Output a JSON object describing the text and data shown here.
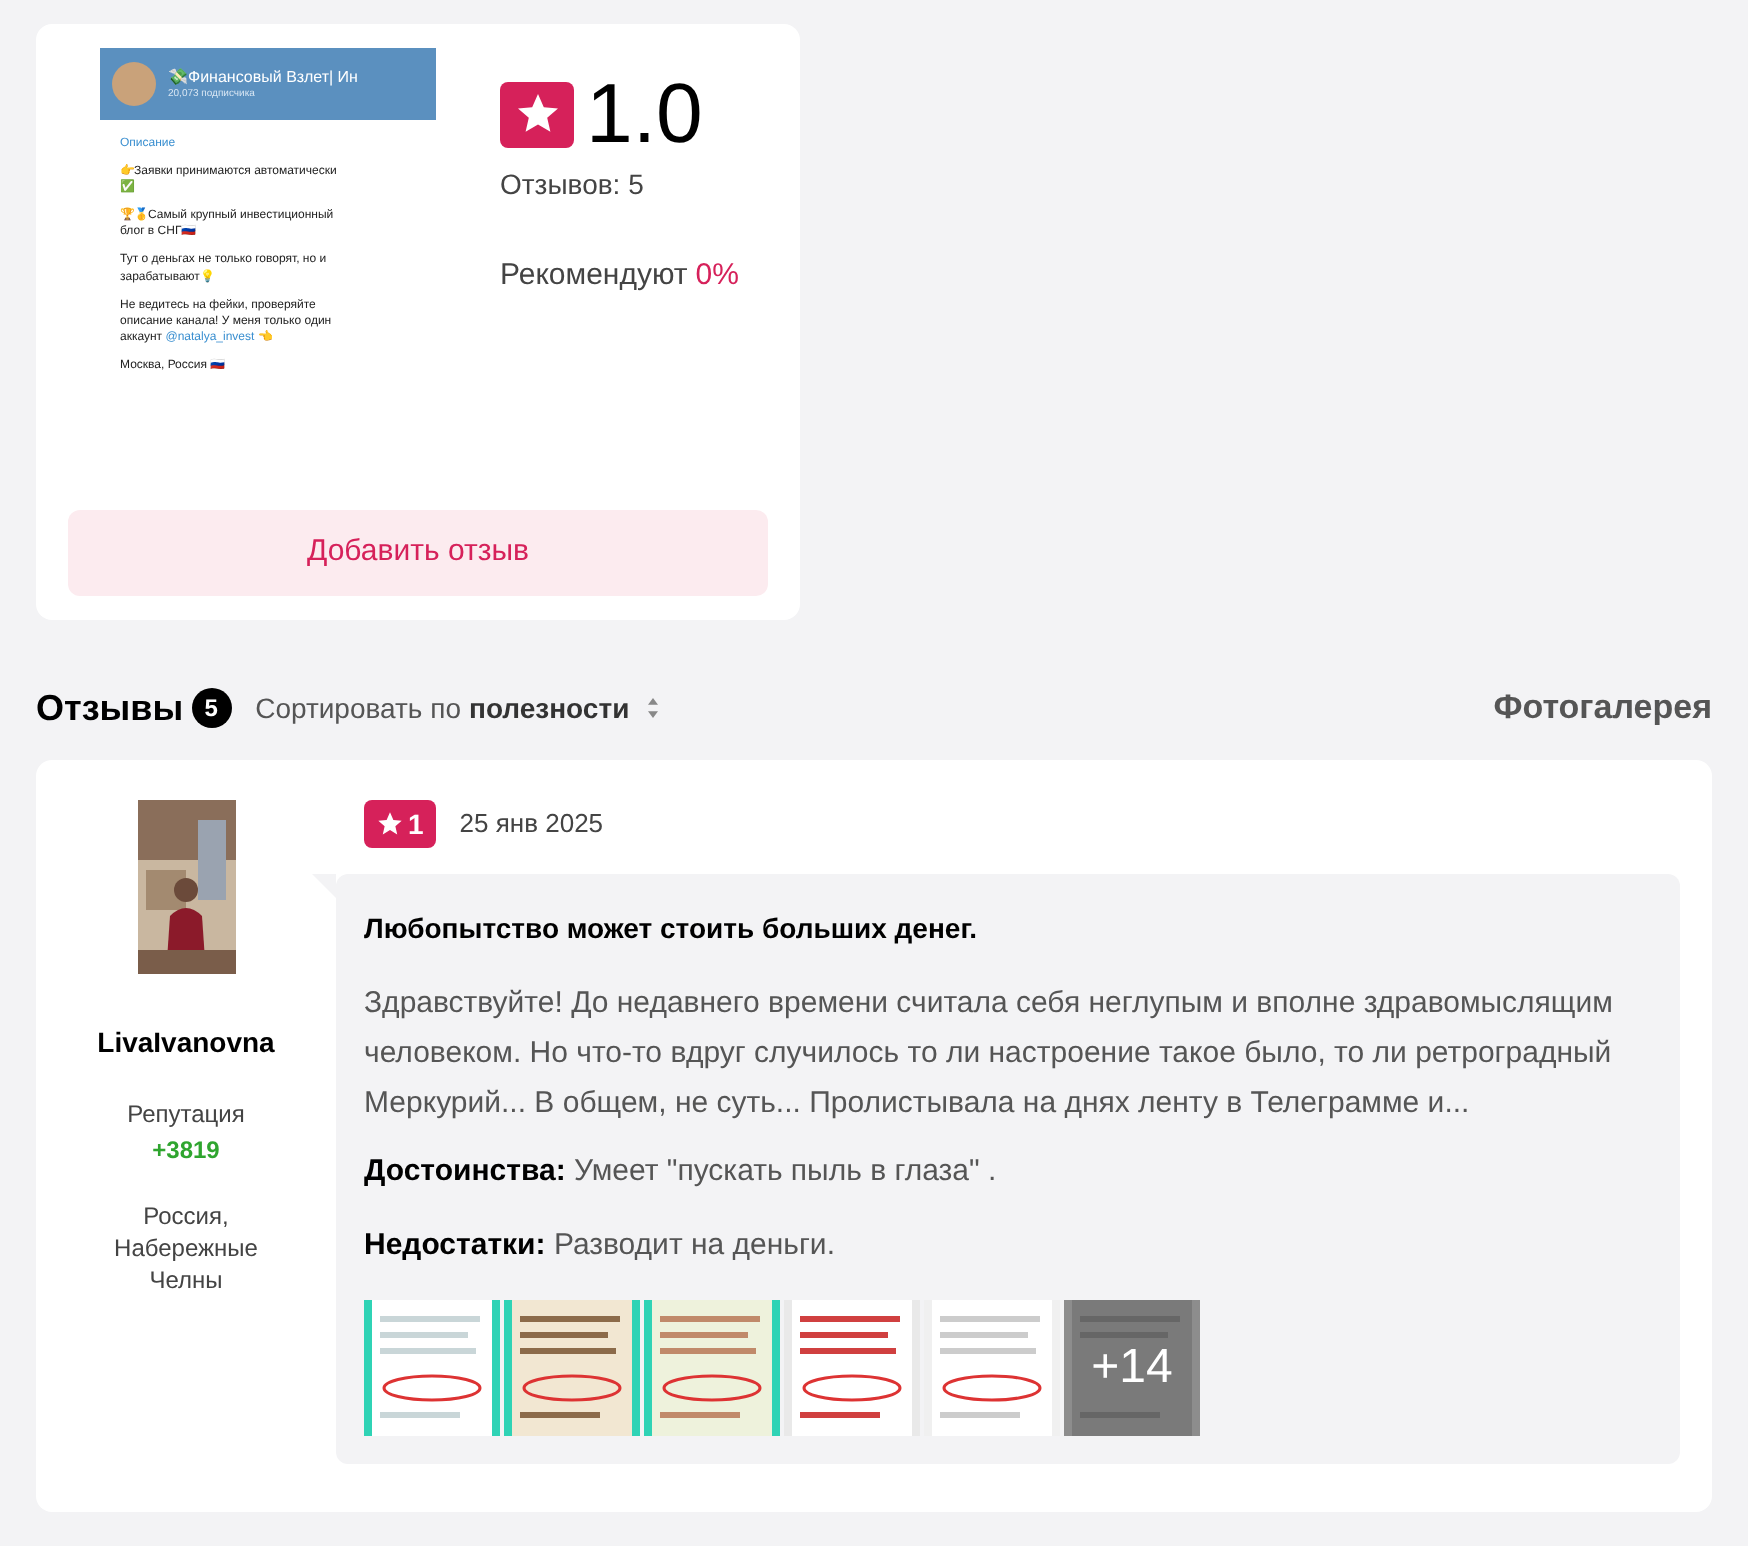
{
  "channel_screenshot": {
    "name": "💸Финансовый Взлет| Ин",
    "subscribers": "20,073 подписчика",
    "section_label": "Описание",
    "paragraphs": [
      "👉Заявки принимаются автоматически ✅",
      "🏆🥇Самый крупный инвестиционный блог в СНГ🇷🇺",
      "Тут о деньгах не только говорят, но и зарабатывают💡",
      "Не ведитесь на фейки, проверяйте описание канала! У меня только один аккаунт",
      "Москва, Россия 🇷🇺"
    ],
    "handle": "@natalya_invest",
    "handle_suffix": "👈"
  },
  "rating": {
    "value": "1.0",
    "reviews_count": "Отзывов: 5",
    "recommend_label": "Рекомендуют",
    "recommend_value": "0%"
  },
  "add_review_button": "Добавить отзыв",
  "reviews_header": {
    "title": "Отзывы",
    "count": "5",
    "sort_label": "Сортировать по",
    "sort_value": "полезности",
    "gallery_link": "Фотогалерея"
  },
  "reviews": [
    {
      "author": "LivaIvanovna",
      "reputation_label": "Репутация",
      "reputation": "+3819",
      "location": "Россия, Набережные Челны",
      "rating": "1",
      "date": "25 янв 2025",
      "title": "Любопытство может стоить больших денег.",
      "text": "Здравствуйте! До недавнего времени считала себя неглупым и вполне здравомыслящим человеком. Но что-то вдруг случилось то ли настроение такое было, то ли ретроградный Меркурий... В общем, не суть... Пролистывала на днях ленту в Телеграмме и...",
      "pros_label": "Достоинства:",
      "pros": "Умеет \"пускать пыль в глаза\" .",
      "cons_label": "Недостатки:",
      "cons": "Разводит на деньги.",
      "photos": [
        {
          "kind": "picture"
        },
        {
          "kind": "picture"
        },
        {
          "kind": "picture"
        },
        {
          "kind": "picture"
        },
        {
          "kind": "picture"
        },
        {
          "kind": "picture",
          "more": "+14"
        }
      ]
    }
  ]
}
